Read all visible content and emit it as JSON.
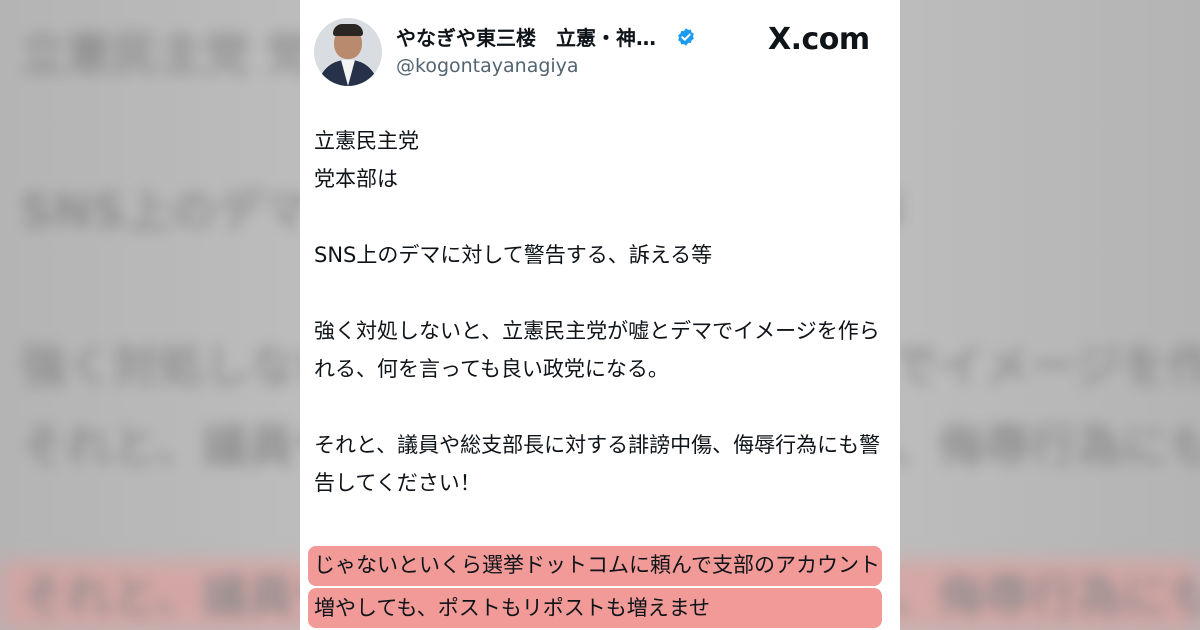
{
  "tweet": {
    "display_name": "やなぎや東三楼　立憲・神…",
    "handle": "@kogontayanagiya",
    "brand": "X.com",
    "paragraphs": [
      "立憲民主党\n党本部は",
      "SNS上のデマに対して警告する、訴える等",
      "強く対処しないと、立憲民主党が嘘とデマでイメージを作られる、何を言っても良い政党になる。",
      "それと、議員や総支部長に対する誹謗中傷、侮辱行為にも警告してください！"
    ],
    "highlighted_text": "じゃないといくら選挙ドットコムに頼んで支部のアカウント増やしても、ポストもリポストも増えませ"
  },
  "colors": {
    "verified": "#1d9bf0",
    "highlight": "#f08f8c",
    "text": "#0f1419",
    "handle": "#536471"
  },
  "icons": {
    "verified": "verified-badge-icon",
    "brand": "x-logo-icon"
  }
}
